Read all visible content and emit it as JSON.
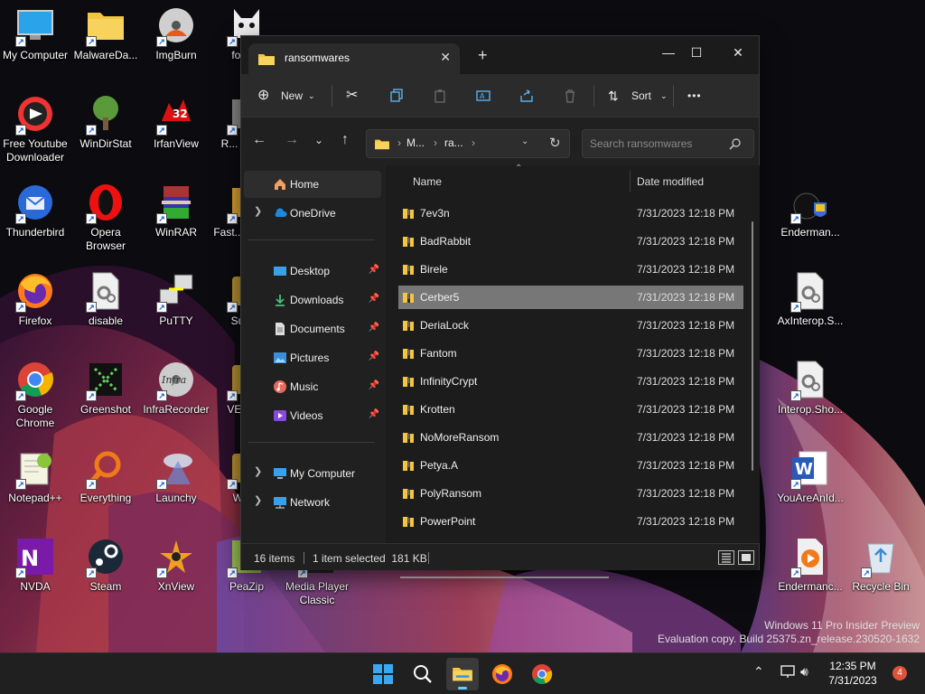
{
  "desktop": {
    "icons": [
      {
        "label": "My Computer",
        "icon": "monitor-icon"
      },
      {
        "label": "MalwareDa...",
        "icon": "folder-icon"
      },
      {
        "label": "ImgBurn",
        "icon": "disc-icon"
      },
      {
        "label": "foob...",
        "icon": "cat-icon"
      },
      {
        "label": "Free Youtube Downloader",
        "icon": "youtube-downloader-icon"
      },
      {
        "label": "WinDirStat",
        "icon": "tree-icon"
      },
      {
        "label": "IrfanView",
        "icon": "irfanview-icon"
      },
      {
        "label": "R... Unin...",
        "icon": "uninstaller-icon"
      },
      {
        "label": "Thunderbird",
        "icon": "thunderbird-icon"
      },
      {
        "label": "Opera Browser",
        "icon": "opera-icon"
      },
      {
        "label": "WinRAR",
        "icon": "winrar-icon"
      },
      {
        "label": "Fast... Imag...",
        "icon": "image-icon"
      },
      {
        "label": "Firefox",
        "icon": "firefox-icon"
      },
      {
        "label": "disable",
        "icon": "settings-file-icon"
      },
      {
        "label": "PuTTY",
        "icon": "putty-icon"
      },
      {
        "label": "Sum...",
        "icon": "app-icon"
      },
      {
        "label": "Google Chrome",
        "icon": "chrome-icon"
      },
      {
        "label": "Greenshot",
        "icon": "greenshot-icon"
      },
      {
        "label": "InfraRecorder",
        "icon": "infrarecorder-icon"
      },
      {
        "label": "VEGA...",
        "icon": "app-icon"
      },
      {
        "label": "Notepad++",
        "icon": "notepadpp-icon"
      },
      {
        "label": "Everything",
        "icon": "everything-icon"
      },
      {
        "label": "Launchy",
        "icon": "launchy-icon"
      },
      {
        "label": "Win...",
        "icon": "app-icon"
      },
      {
        "label": "NVDA",
        "icon": "nvda-icon"
      },
      {
        "label": "Steam",
        "icon": "steam-icon"
      },
      {
        "label": "XnView",
        "icon": "xnview-icon"
      },
      {
        "label": "PeaZip",
        "icon": "peazip-icon"
      },
      {
        "label": "Media Player Classic",
        "icon": "media-player-icon"
      },
      {
        "label": "Enderman...",
        "icon": "bomb-shield-icon"
      },
      {
        "label": "AxInterop.S...",
        "icon": "settings-file-icon"
      },
      {
        "label": "Interop.Sho...",
        "icon": "settings-file-icon"
      },
      {
        "label": "YouAreAnId...",
        "icon": "word-icon"
      },
      {
        "label": "Endermanc...",
        "icon": "video-file-icon"
      },
      {
        "label": "Recycle Bin",
        "icon": "recycle-bin-icon"
      }
    ]
  },
  "explorer": {
    "tab_title": "ransomwares",
    "toolbar": {
      "new_label": "New",
      "sort_label": "Sort",
      "more_label": "•••"
    },
    "address": {
      "crumb1": "M...",
      "crumb2": "ra..."
    },
    "search_placeholder": "Search ransomwares",
    "sidebar": {
      "home": "Home",
      "onedrive": "OneDrive",
      "desktop": "Desktop",
      "downloads": "Downloads",
      "documents": "Documents",
      "pictures": "Pictures",
      "music": "Music",
      "videos": "Videos",
      "mycomputer": "My Computer",
      "network": "Network"
    },
    "columns": {
      "name": "Name",
      "date": "Date modified"
    },
    "files": [
      {
        "name": "7ev3n",
        "date": "7/31/2023 12:18 PM"
      },
      {
        "name": "BadRabbit",
        "date": "7/31/2023 12:18 PM"
      },
      {
        "name": "Birele",
        "date": "7/31/2023 12:18 PM"
      },
      {
        "name": "Cerber5",
        "date": "7/31/2023 12:18 PM"
      },
      {
        "name": "DeriaLock",
        "date": "7/31/2023 12:18 PM"
      },
      {
        "name": "Fantom",
        "date": "7/31/2023 12:18 PM"
      },
      {
        "name": "InfinityCrypt",
        "date": "7/31/2023 12:18 PM"
      },
      {
        "name": "Krotten",
        "date": "7/31/2023 12:18 PM"
      },
      {
        "name": "NoMoreRansom",
        "date": "7/31/2023 12:18 PM"
      },
      {
        "name": "Petya.A",
        "date": "7/31/2023 12:18 PM"
      },
      {
        "name": "PolyRansom",
        "date": "7/31/2023 12:18 PM"
      },
      {
        "name": "PowerPoint",
        "date": "7/31/2023 12:18 PM"
      }
    ],
    "status": {
      "count": "16 items",
      "selected": "1 item selected  181 KB"
    }
  },
  "watermark": {
    "line1": "Windows 11 Pro Insider Preview",
    "line2": "Evaluation copy. Build 25375.zn_release.230520-1632"
  },
  "taskbar": {
    "time": "12:35 PM",
    "date": "7/31/2023",
    "notifications": "4"
  },
  "colors": {
    "accent": "#60cdff",
    "selection": "#777777",
    "folder": "#f4c542"
  }
}
